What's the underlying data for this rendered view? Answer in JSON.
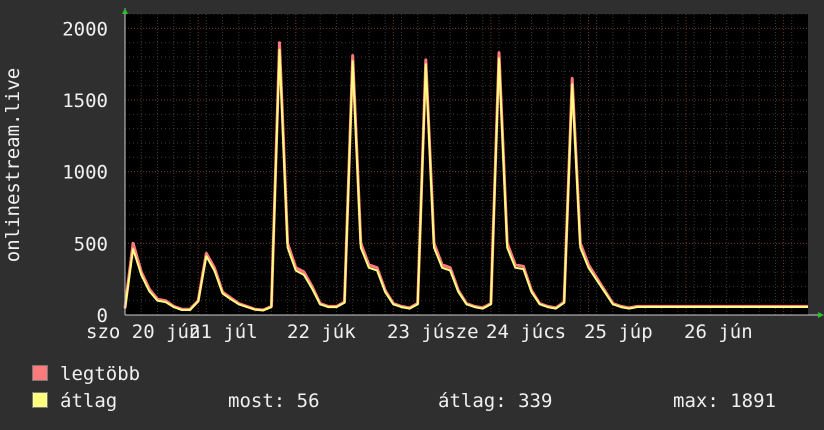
{
  "chart_data": {
    "type": "area",
    "ylabel": "onlinestream.live",
    "ylim": [
      0,
      2100
    ],
    "y_ticks": [
      0,
      500,
      1000,
      1500,
      2000
    ],
    "x_tick_labels": [
      "szo 20 jún",
      "21 júl",
      "22 júk",
      "23 júsze",
      "24 júcs",
      "25 júp",
      "26 jún"
    ],
    "series": [
      {
        "name": "legtöbb",
        "color": "#ff7a7a",
        "x_hours": [
          0,
          2,
          4,
          6,
          8,
          10,
          12,
          14,
          16,
          18,
          20,
          22,
          24,
          26,
          28,
          30,
          32,
          34,
          36,
          38,
          40,
          42,
          44,
          46,
          48,
          50,
          52,
          54,
          56,
          58,
          60,
          62,
          64,
          66,
          68,
          70,
          72,
          74,
          76,
          78,
          80,
          82,
          84,
          86,
          88,
          90,
          92,
          94,
          96,
          98,
          100,
          102,
          104,
          106,
          108,
          110,
          112,
          114,
          116,
          118,
          120,
          122,
          124,
          126,
          128,
          130,
          132,
          134,
          136,
          138,
          140,
          142,
          144,
          146,
          148,
          150,
          152,
          154,
          156,
          158,
          160,
          162,
          164,
          166,
          168
        ],
        "values": [
          50,
          500,
          300,
          180,
          110,
          100,
          60,
          40,
          40,
          100,
          430,
          330,
          160,
          120,
          80,
          60,
          40,
          35,
          60,
          1900,
          500,
          330,
          300,
          200,
          80,
          60,
          60,
          90,
          1810,
          500,
          350,
          330,
          170,
          80,
          60,
          50,
          80,
          1780,
          500,
          350,
          330,
          170,
          80,
          60,
          50,
          80,
          1830,
          500,
          350,
          340,
          170,
          80,
          60,
          50,
          90,
          1650,
          500,
          350,
          260,
          170,
          80,
          60,
          50,
          60,
          60,
          60,
          60,
          60,
          60,
          60,
          60,
          60,
          60,
          60,
          60,
          60,
          60,
          60,
          60,
          60,
          60,
          60,
          60,
          60,
          60
        ]
      },
      {
        "name": "átlag",
        "color": "#ffff7f",
        "values": [
          45,
          460,
          280,
          165,
          100,
          90,
          55,
          35,
          35,
          95,
          410,
          310,
          150,
          110,
          75,
          55,
          38,
          32,
          55,
          1850,
          470,
          310,
          280,
          185,
          75,
          55,
          55,
          85,
          1770,
          470,
          330,
          310,
          160,
          75,
          55,
          45,
          75,
          1750,
          470,
          330,
          310,
          160,
          75,
          55,
          45,
          75,
          1790,
          470,
          330,
          320,
          160,
          75,
          55,
          45,
          85,
          1610,
          470,
          330,
          245,
          160,
          75,
          55,
          45,
          56,
          56,
          56,
          56,
          56,
          56,
          56,
          56,
          56,
          56,
          56,
          56,
          56,
          56,
          56,
          56,
          56,
          56,
          56,
          56,
          56,
          56
        ]
      }
    ],
    "stats": {
      "most": "56",
      "atlag": "339",
      "max": "1891"
    }
  },
  "legend": {
    "max_label": "legtöbb",
    "avg_label": "átlag"
  },
  "stats_text": {
    "most": "most: 56",
    "atlag": "átlag: 339",
    "max": "max: 1891"
  }
}
